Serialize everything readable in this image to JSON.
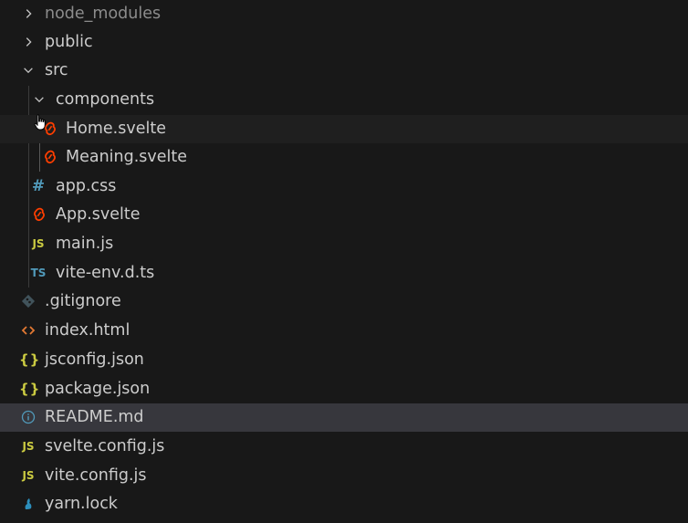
{
  "explorer": {
    "items": [
      {
        "label": "node_modules"
      },
      {
        "label": "public"
      },
      {
        "label": "src"
      },
      {
        "label": "components"
      },
      {
        "label": "Home.svelte"
      },
      {
        "label": "Meaning.svelte"
      },
      {
        "label": "app.css",
        "icon_text": "#"
      },
      {
        "label": "App.svelte"
      },
      {
        "label": "main.js",
        "icon_text": "JS"
      },
      {
        "label": "vite-env.d.ts",
        "icon_text": "TS"
      },
      {
        "label": ".gitignore"
      },
      {
        "label": "index.html"
      },
      {
        "label": "jsconfig.json",
        "icon_text": "{}"
      },
      {
        "label": "package.json",
        "icon_text": "{}"
      },
      {
        "label": "README.md"
      },
      {
        "label": "svelte.config.js",
        "icon_text": "JS"
      },
      {
        "label": "vite.config.js",
        "icon_text": "JS"
      },
      {
        "label": "yarn.lock"
      }
    ]
  },
  "colors": {
    "background": "#181818",
    "selected_row": "#37373d",
    "hover_row": "#1f1f1f",
    "text": "#cccccc",
    "svelte_icon": "#ff3e00",
    "js_icon": "#cbcb41",
    "ts_icon": "#519aba",
    "html_icon": "#e37933",
    "git_icon": "#41535b",
    "info_icon": "#519aba",
    "yarn_icon": "#2c8ebb"
  }
}
